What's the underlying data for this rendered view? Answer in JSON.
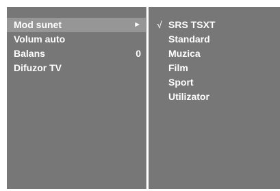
{
  "menu": {
    "items": [
      {
        "label": "Mod sunet",
        "value": "",
        "arrow": "►",
        "selected": true
      },
      {
        "label": "Volum auto",
        "value": ""
      },
      {
        "label": "Balans",
        "value": "0"
      },
      {
        "label": "Difuzor TV",
        "value": ""
      }
    ]
  },
  "submenu": {
    "check_mark": "√",
    "options": [
      {
        "label": "SRS  TSXT",
        "checked": true
      },
      {
        "label": "Standard",
        "checked": false
      },
      {
        "label": "Muzica",
        "checked": false
      },
      {
        "label": "Film",
        "checked": false
      },
      {
        "label": "Sport",
        "checked": false
      },
      {
        "label": "Utilizator",
        "checked": false
      }
    ]
  },
  "colors": {
    "panel": "#777777",
    "highlight": "#969696",
    "text": "#ffffff"
  }
}
